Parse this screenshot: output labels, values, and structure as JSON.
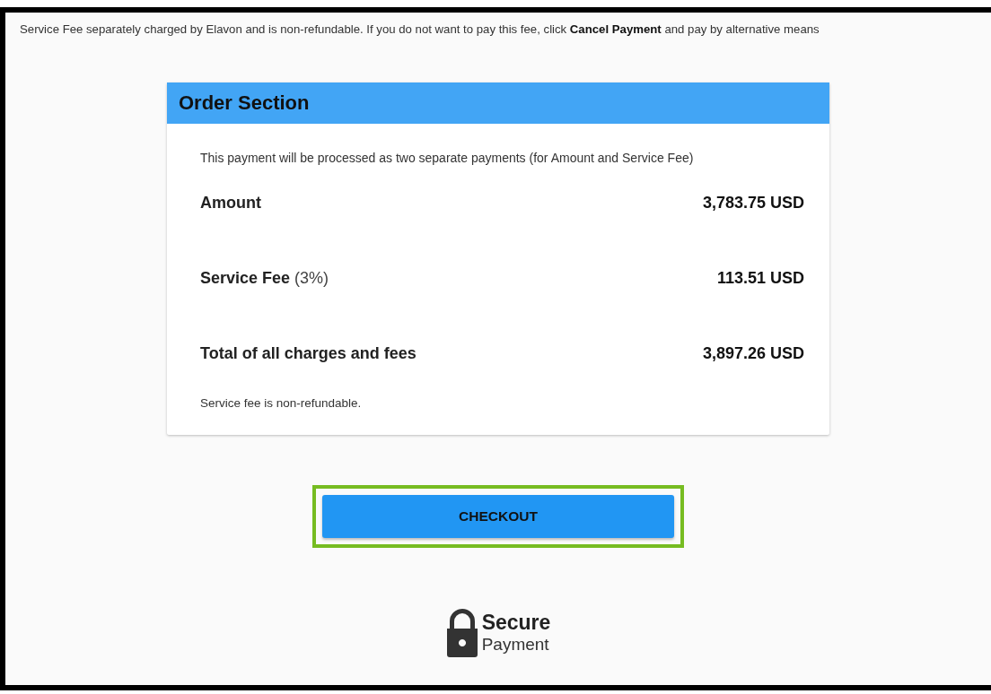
{
  "notice": "Service Fee separately charged by Elavon and is non-refundable. If you do not want to pay this fee, click **Cancel Payment** and pay by alternative means",
  "order": {
    "title": "Order Section",
    "intro": "This payment will be processed as two separate payments (for Amount and Service Fee)",
    "lines": [
      {
        "label": "Amount",
        "value": "3,783.75 USD"
      },
      {
        "label": "Service Fee",
        "note": "(3%)",
        "value": "113.51 USD"
      },
      {
        "label": "Total of all charges and fees",
        "value": "3,897.26 USD"
      }
    ],
    "footnote": "Service fee is non-refundable."
  },
  "checkout_button": {
    "label": "CHECKOUT",
    "highlighted": true
  },
  "secure_badge": {
    "title": "Secure",
    "subtitle": "Payment"
  }
}
